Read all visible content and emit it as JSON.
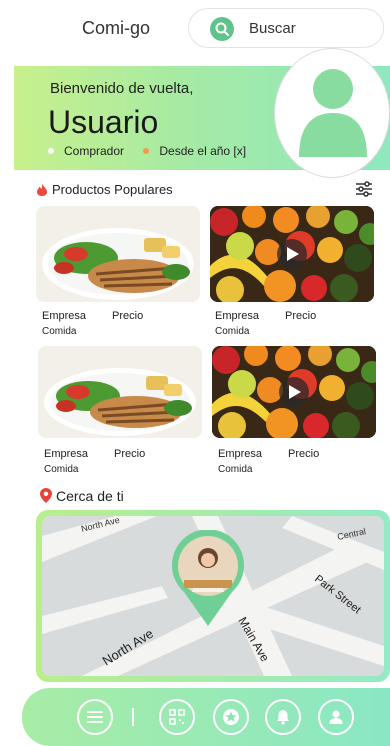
{
  "header": {
    "app_title": "Comi-go",
    "search_label": "Buscar",
    "search_icon": "search-icon"
  },
  "welcome": {
    "greeting": "Bienvenido de vuelta,",
    "username": "Usuario",
    "role": "Comprador",
    "since": "Desde el año [x]"
  },
  "popular": {
    "title": "Productos Populares",
    "cards": [
      {
        "company": "Empresa",
        "price": "Precio",
        "category": "Comida",
        "image": "grilled-chicken-salad"
      },
      {
        "company": "Empresa",
        "price": "Precio",
        "category": "Comida",
        "image": "fruit-assortment-video"
      },
      {
        "company": "Empresa",
        "price": "Precio",
        "category": "Comida",
        "image": "grilled-chicken-salad"
      },
      {
        "company": "Empresa",
        "price": "Precio",
        "category": "Comida",
        "image": "fruit-assortment-video"
      }
    ]
  },
  "nearby": {
    "title": "Cerca de ti",
    "streets": [
      "North Ave",
      "Main Ave",
      "Park Street",
      "Central"
    ]
  },
  "nav": {
    "items": [
      "menu-icon",
      "qr-code-icon",
      "star-icon",
      "bell-icon",
      "user-icon"
    ]
  },
  "colors": {
    "accent_green": "#5fc38c",
    "gradient_start": "#c8f08c",
    "gradient_end": "#8fe8c0",
    "flame": "#e84b3c",
    "pin": "#e8433a"
  }
}
